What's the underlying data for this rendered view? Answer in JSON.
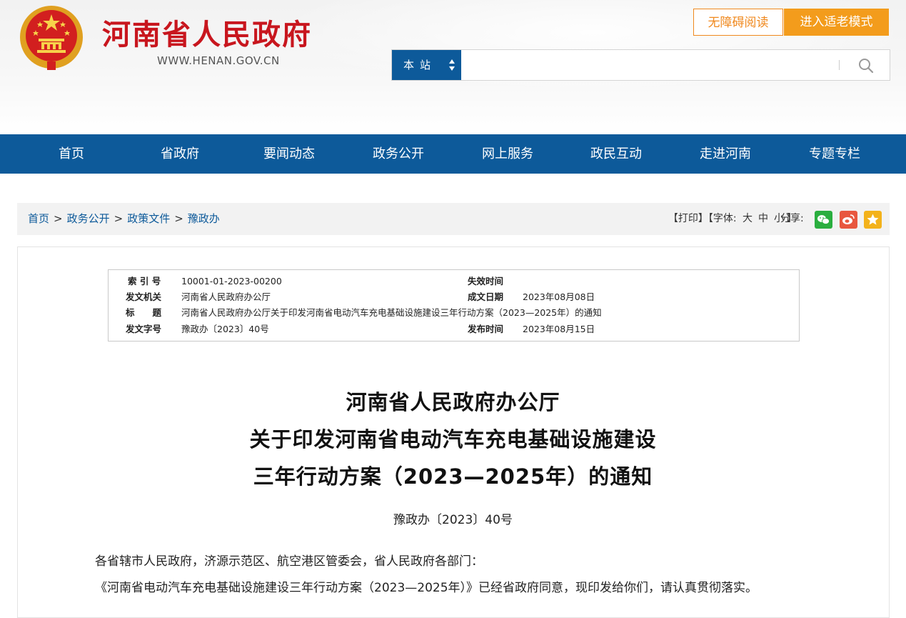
{
  "header": {
    "site_title": "河南省人民政府",
    "site_url": "WWW.HENAN.GOV.CN",
    "accessibility_label": "无障碍阅读",
    "elder_mode_label": "进入适老模式",
    "search": {
      "scope_label": "本站",
      "placeholder": "",
      "value": ""
    }
  },
  "nav": {
    "items": [
      {
        "label": "首页"
      },
      {
        "label": "省政府"
      },
      {
        "label": "要闻动态"
      },
      {
        "label": "政务公开"
      },
      {
        "label": "网上服务"
      },
      {
        "label": "政民互动"
      },
      {
        "label": "走进河南"
      },
      {
        "label": "专题专栏"
      }
    ]
  },
  "breadcrumb": {
    "items": [
      "首页",
      "政务公开",
      "政策文件",
      "豫政办"
    ],
    "separator": ">"
  },
  "tools": {
    "print_label": "【打印】",
    "font_label_prefix": "【字体:",
    "font_large": "大",
    "font_medium": "中",
    "font_small": "小",
    "font_label_suffix": "】",
    "share_label": "分享:",
    "share_icons": [
      "wechat-icon",
      "weibo-icon",
      "favorite-icon"
    ]
  },
  "meta": {
    "index_label": "索 引 号",
    "index_value": "10001-01-2023-00200",
    "expiry_label": "失效时间",
    "expiry_value": "",
    "issuer_label": "发文机关",
    "issuer_value": "河南省人民政府办公厅",
    "created_label": "成文日期",
    "created_value": "2023年08月08日",
    "title_label": "标　　题",
    "title_value": "河南省人民政府办公厅关于印发河南省电动汽车充电基础设施建设三年行动方案（2023—2025年）的通知",
    "docno_label": "发文字号",
    "docno_value": "豫政办〔2023〕40号",
    "published_label": "发布时间",
    "published_value": "2023年08月15日"
  },
  "document": {
    "title_line1": "河南省人民政府办公厅",
    "title_line2": "关于印发河南省电动汽车充电基础设施建设",
    "title_line3": "三年行动方案（2023—2025年）的通知",
    "doc_number": "豫政办〔2023〕40号",
    "recipients": "各省辖市人民政府，济源示范区、航空港区管委会，省人民政府各部门：",
    "paragraph1": "《河南省电动汽车充电基础设施建设三年行动方案（2023—2025年）》已经省政府同意，现印发给你们，请认真贯彻落实。"
  },
  "colors": {
    "brand_red": "#c8161e",
    "nav_blue": "#0d5a9a",
    "accent_orange": "#f39c1c"
  }
}
